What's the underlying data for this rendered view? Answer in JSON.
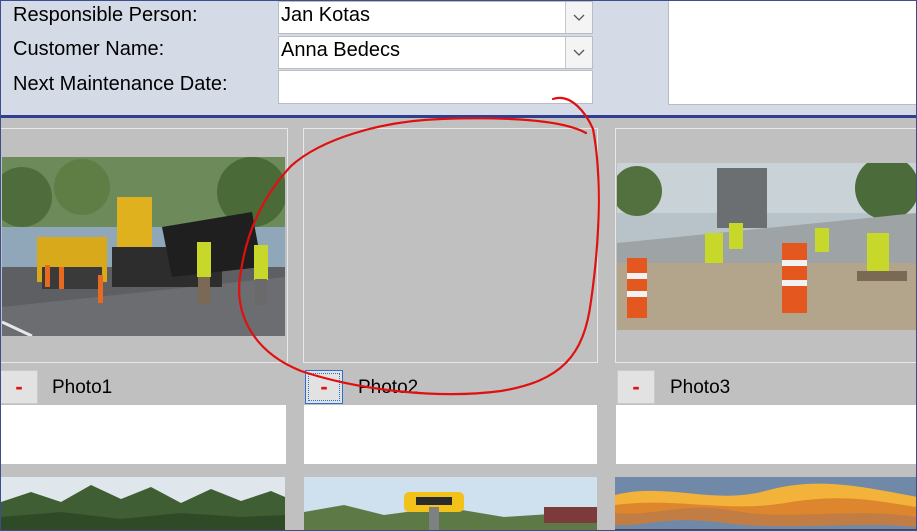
{
  "form": {
    "responsible_label": "Responsible Person:",
    "responsible_value": "Jan Kotas",
    "customer_label": "Customer Name:",
    "customer_value": "Anna Bedecs",
    "maintenance_label": "Next Maintenance Date:",
    "maintenance_value": ""
  },
  "photos": [
    {
      "label": "Photo1",
      "delete_label": "-",
      "has_image": true
    },
    {
      "label": "Photo2",
      "delete_label": "-",
      "has_image": false
    },
    {
      "label": "Photo3",
      "delete_label": "-",
      "has_image": true
    }
  ],
  "icons": {
    "dropdown": "chevron-down-icon",
    "annotation": "red-freehand-circle"
  },
  "colors": {
    "form_background": "#d4dbe6",
    "divider": "#2f3e8f",
    "gallery_background": "#c0c0c0",
    "delete_glyph": "#e01010",
    "annotation": "#e01010"
  }
}
